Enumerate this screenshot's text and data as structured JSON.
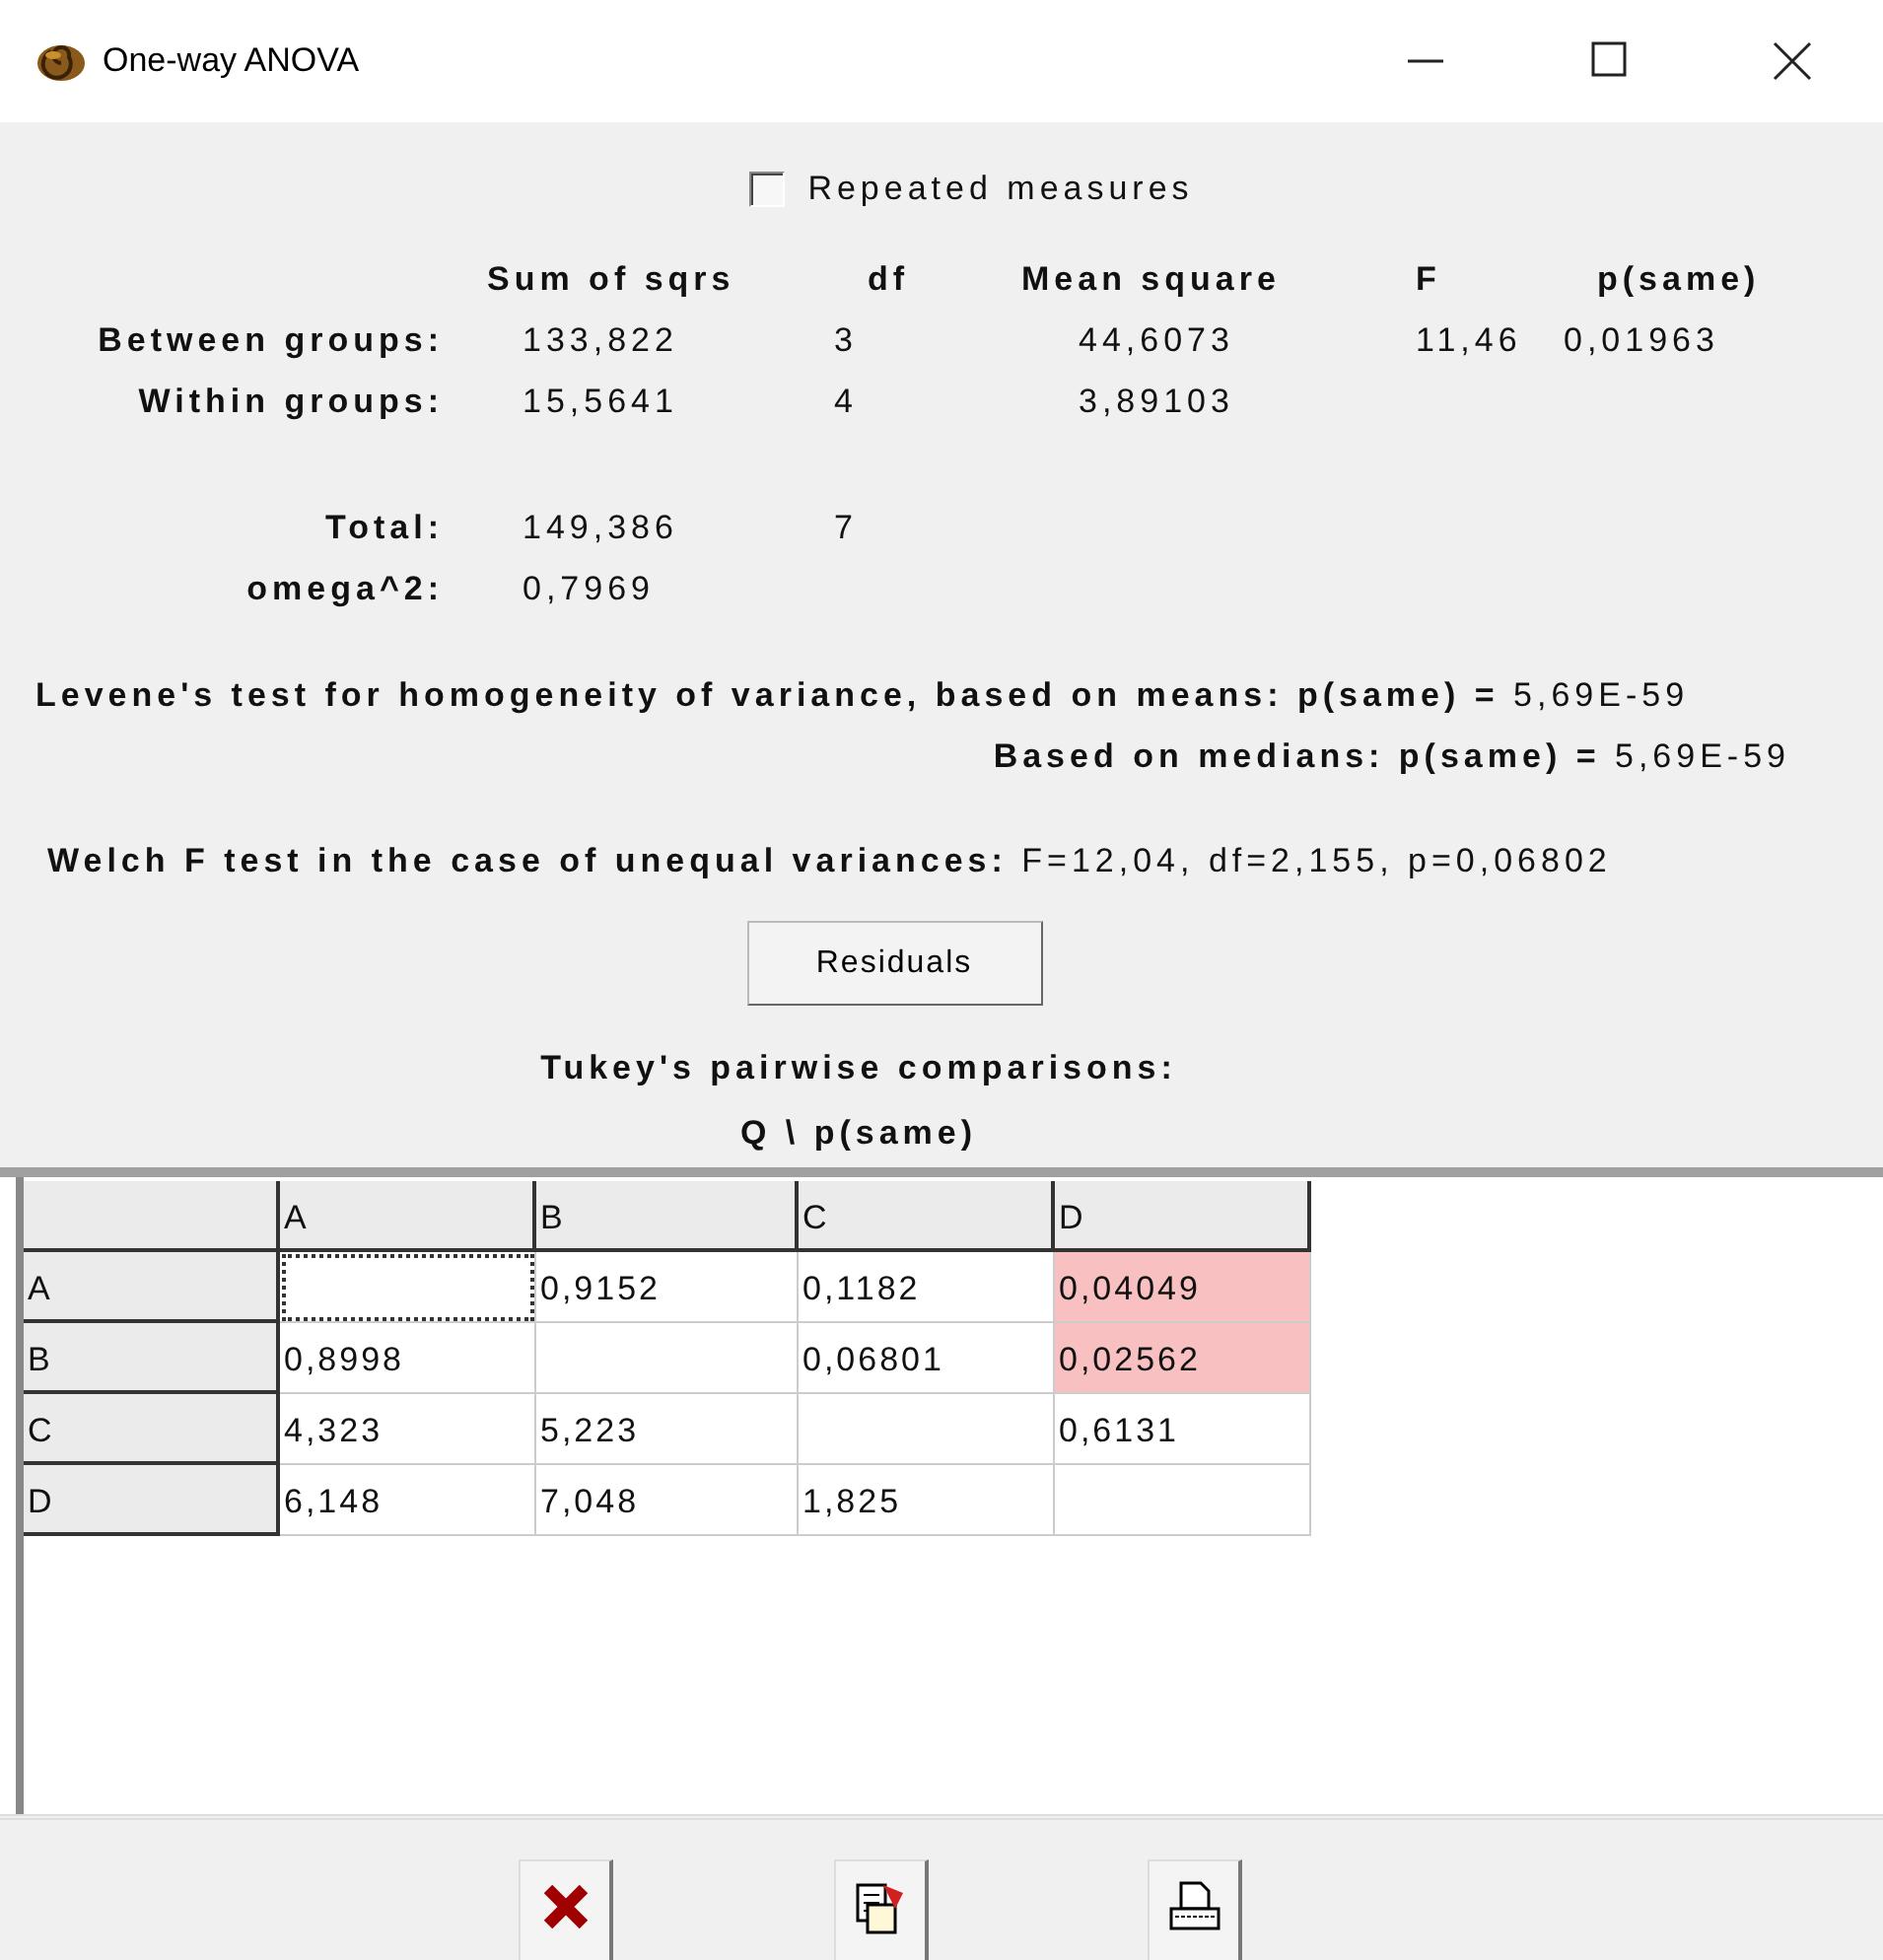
{
  "window": {
    "title": "One-way ANOVA"
  },
  "repeated_measures": {
    "label": "Repeated measures",
    "checked": false
  },
  "anova_table": {
    "columns": [
      "Sum of sqrs",
      "df",
      "Mean square",
      "F",
      "p(same)"
    ],
    "rows": [
      {
        "label": "Between groups:",
        "values": [
          "133,822",
          "3",
          "44,6073",
          "11,46",
          "0,01963"
        ]
      },
      {
        "label": "Within groups:",
        "values": [
          "15,5641",
          "4",
          "3,89103"
        ]
      },
      {
        "label": "Total:",
        "values": [
          "149,386",
          "7"
        ]
      },
      {
        "label": "omega^2:",
        "values": [
          "0,7969"
        ]
      }
    ]
  },
  "levene": [
    "**Levene's test for homogeneity of variance, based on means:  p(same) =** 5,69E-59",
    "**Based on medians: p(same) =** 5,69E-59"
  ],
  "welch": "**Welch F test in the case of unequal variances:** F=12,04, df=2,155, p=0,06802",
  "residuals_button": "Residuals",
  "tukey": {
    "title": "Tukey's pairwise comparisons:",
    "subtitle": "Q \\ p(same)",
    "columns": [
      "A",
      "B",
      "C",
      "D"
    ],
    "rows": [
      {
        "label": "A",
        "cells": [
          {
            "focused": true,
            "highlighted": false
          },
          {
            "text": "0,9152",
            "focused": false,
            "highlighted": false
          },
          {
            "text": "0,1182",
            "focused": false,
            "highlighted": false
          },
          {
            "text": "0,04049",
            "focused": false,
            "highlighted": true
          }
        ]
      },
      {
        "label": "B",
        "cells": [
          {
            "text": "0,8998",
            "focused": false,
            "highlighted": false
          },
          {
            "focused": false,
            "highlighted": false
          },
          {
            "text": "0,06801",
            "focused": false,
            "highlighted": false
          },
          {
            "text": "0,02562",
            "focused": false,
            "highlighted": true
          }
        ]
      },
      {
        "label": "C",
        "cells": [
          {
            "text": "4,323",
            "focused": false,
            "highlighted": false
          },
          {
            "text": "5,223",
            "focused": false,
            "highlighted": false
          },
          {
            "focused": false,
            "highlighted": false
          },
          {
            "text": "0,6131",
            "focused": false,
            "highlighted": false
          }
        ]
      },
      {
        "label": "D",
        "cells": [
          {
            "text": "6,148",
            "focused": false,
            "highlighted": false
          },
          {
            "text": "7,048",
            "focused": false,
            "highlighted": false
          },
          {
            "text": "1,825",
            "focused": false,
            "highlighted": false
          },
          {
            "focused": false,
            "highlighted": false
          }
        ]
      }
    ]
  },
  "toolbar": [
    {
      "kind": "close"
    },
    {
      "kind": "copy"
    },
    {
      "kind": "print"
    }
  ]
}
